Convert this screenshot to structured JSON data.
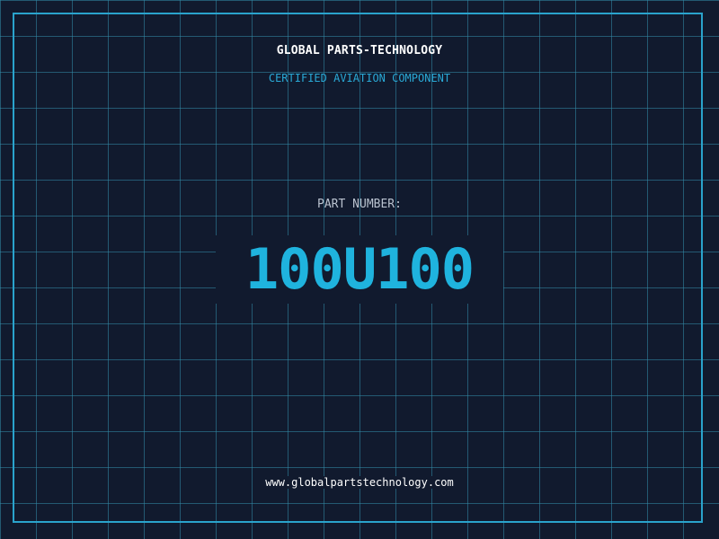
{
  "header": {
    "brand": "GLOBAL PARTS-TECHNOLOGY",
    "tagline": "CERTIFIED AVIATION COMPONENT"
  },
  "part": {
    "label": "PART NUMBER:",
    "number": "100U100"
  },
  "footer": {
    "website": "www.globalpartstechnology.com"
  },
  "colors": {
    "background": "#111a2e",
    "grid": "#328caa",
    "frame": "#2aa3cc",
    "accent": "#1fb3de",
    "tagline": "#29a9d6",
    "label": "#b9c2cf",
    "text": "#ffffff"
  }
}
